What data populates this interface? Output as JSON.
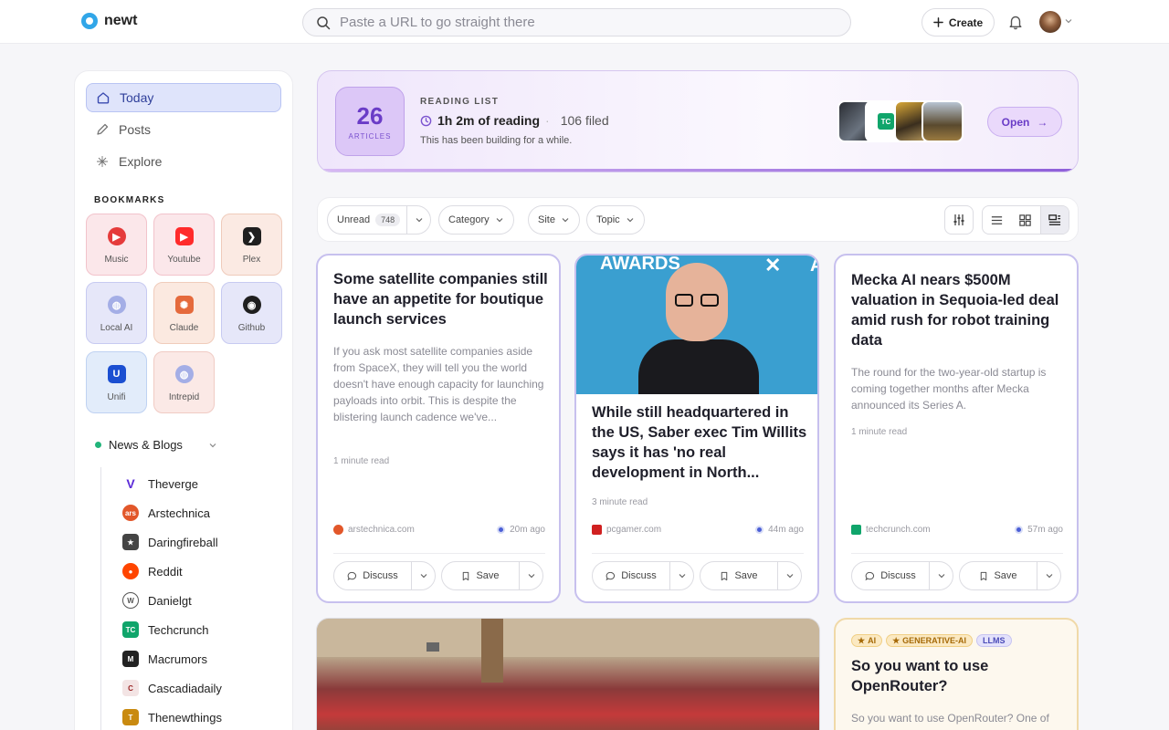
{
  "app": {
    "name": "newt"
  },
  "search": {
    "placeholder": "Paste a URL to go straight there"
  },
  "header": {
    "create_label": "Create"
  },
  "nav": [
    {
      "label": "Today",
      "icon": "home-icon",
      "active": true
    },
    {
      "label": "Posts",
      "icon": "pencil-icon",
      "active": false
    },
    {
      "label": "Explore",
      "icon": "sparkle-icon",
      "active": false
    }
  ],
  "bookmarks": {
    "label": "BOOKMARKS",
    "items": [
      {
        "label": "Music",
        "icon": "music-icon",
        "color": "#e53b3b",
        "bg": "#fbe7ea"
      },
      {
        "label": "Youtube",
        "icon": "youtube-icon",
        "color": "#ff2b2b",
        "bg": "#fbe7ea"
      },
      {
        "label": "Plex",
        "icon": "plex-icon",
        "color": "#1f1f1f",
        "bg": "#fbeae3"
      },
      {
        "label": "Local AI",
        "icon": "globe-icon",
        "color": "#7d8ad6",
        "bg": "#e6e7f9"
      },
      {
        "label": "Claude",
        "icon": "claude-icon",
        "color": "#e56a3c",
        "bg": "#fbe9e0"
      },
      {
        "label": "Github",
        "icon": "github-icon",
        "color": "#1f1f1f",
        "bg": "#e6e7f9"
      },
      {
        "label": "Unifi",
        "icon": "unifi-icon",
        "color": "#1b4fd1",
        "bg": "#e2ecfa"
      },
      {
        "label": "Intrepid",
        "icon": "globe-icon",
        "color": "#7d8ad6",
        "bg": "#fbe9e6"
      }
    ]
  },
  "feeds": {
    "group_label": "News & Blogs",
    "items": [
      {
        "label": "Theverge",
        "glyph": "V",
        "color": "#5b2bd8"
      },
      {
        "label": "Arstechnica",
        "glyph": "ars",
        "color": "#e2572a"
      },
      {
        "label": "Daringfireball",
        "glyph": "★",
        "color": "#444444"
      },
      {
        "label": "Reddit",
        "glyph": "●",
        "color": "#ff4500"
      },
      {
        "label": "Danielgt",
        "glyph": "W",
        "color": "#555555"
      },
      {
        "label": "Techcrunch",
        "glyph": "TC",
        "color": "#10a56b"
      },
      {
        "label": "Macrumors",
        "glyph": "M",
        "color": "#b02a2a"
      },
      {
        "label": "Cascadiadaily",
        "glyph": "C",
        "color": "#9a2222"
      },
      {
        "label": "Thenewthings",
        "glyph": "T",
        "color": "#c98a10"
      }
    ]
  },
  "reading_list": {
    "count": "26",
    "count_label": "ARTICLES",
    "label": "READING LIST",
    "time": "1h 2m of reading",
    "filed": "106 filed",
    "subtitle": "This has been building for a while.",
    "open_label": "Open"
  },
  "filters": {
    "unread_label": "Unread",
    "unread_count": "748",
    "category_label": "Category",
    "site_label": "Site",
    "topic_label": "Topic"
  },
  "cards": [
    {
      "title": "Some satellite companies still have an appetite for boutique launch services",
      "excerpt": "If you ask most satellite companies aside from SpaceX, they will tell you the world doesn't have enough capacity for launching payloads into orbit. This is despite the blistering launch cadence we've...",
      "read_time": "1 minute read",
      "site": "arstechnica.com",
      "age": "20m ago",
      "discuss": "Discuss",
      "save": "Save"
    },
    {
      "image_banner": "AWARDS",
      "title": "While still headquartered in the US, Saber exec Tim Willits says it has 'no real development in North...",
      "read_time": "3 minute read",
      "site": "pcgamer.com",
      "age": "44m ago",
      "discuss": "Discuss",
      "save": "Save"
    },
    {
      "title": "Mecka AI nears $500M valuation in Sequoia-led deal amid rush for robot training data",
      "excerpt": "The round for the two-year-old startup is coming together months after Mecka announced its Series A.",
      "read_time": "1 minute read",
      "site": "techcrunch.com",
      "age": "57m ago",
      "discuss": "Discuss",
      "save": "Save"
    },
    {
      "tags": [
        "AI",
        "GENERATIVE-AI",
        "LLMS"
      ],
      "title": "So you want to use OpenRouter?",
      "excerpt": "So you want to use OpenRouter? One of"
    }
  ],
  "colors": {
    "accent": "#6a3cc7",
    "active_nav": "#dfe4fb",
    "card_border": "#c7c0ee"
  }
}
